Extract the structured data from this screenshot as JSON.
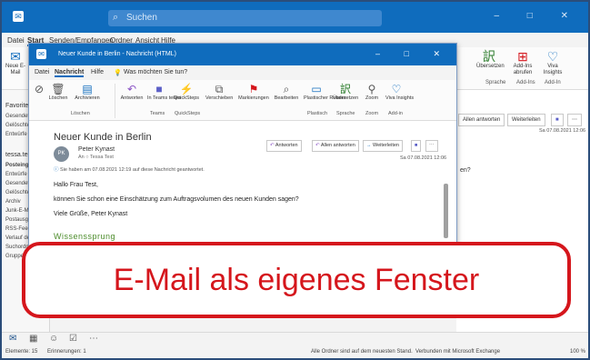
{
  "main_window": {
    "search_placeholder": "Suchen",
    "window_controls": "– □ ✕",
    "menu": [
      "Datei",
      "Start",
      "Senden/Empfangen",
      "Ordner",
      "Ansicht",
      "Hilfe"
    ],
    "ribbon_left": {
      "new_mail": "Neue E-Mail"
    },
    "ribbon_right": {
      "search_fragment": "Suchen",
      "translate": "Übersetzen",
      "addins": "Add-Ins abrufen",
      "viva": "Viva Insights",
      "group_sprache": "Sprache",
      "group_addin1": "Add-Ins",
      "group_addin2": "Add-In"
    },
    "folders": [
      "Favoriten",
      "Gesendete",
      "Gelöschte",
      "Entwürfe",
      "tessa.test",
      "Posteingang",
      "Entwürfe",
      "Gesendete",
      "Gelöschte",
      "Archiv",
      "Junk-E-Mail",
      "Postausgang",
      "RSS-Feeds",
      "Verlauf der",
      "Suchordner",
      "Gruppen"
    ],
    "right_pane": {
      "reply_all": "Allen antworten",
      "forward": "Weiterleiten",
      "date": "Sa 07.08.2021 12:06",
      "question_fragment": "en?"
    },
    "status": {
      "items": "Elemente: 15",
      "unread": "Erinnerungen: 1",
      "sync": "Alle Ordner sind auf dem neuesten Stand.",
      "connected": "Verbunden mit Microsoft Exchange",
      "zoom": "100 %"
    }
  },
  "message_window": {
    "title": "Neuer Kunde in Berlin - Nachricht (HTML)",
    "window_controls": "– □ ✕",
    "menu": {
      "file": "Datei",
      "message": "Nachricht",
      "help": "Hilfe",
      "tellme": "Was möchten Sie tun?"
    },
    "ribbon": {
      "delete": "Löschen",
      "archive": "Archivieren",
      "respond": "Antworten",
      "teams": "In Teams teilen",
      "quicksteps": "QuickSteps",
      "move": "Verschieben",
      "tags": "Markierungen",
      "edit": "Bearbeiten",
      "reader": "Plastischer Reader",
      "translate": "Übersetzen",
      "zoom": "Zoom",
      "viva": "Viva Insights",
      "groups": [
        "Löschen",
        "Teams",
        "QuickSteps",
        "Plastisch",
        "Sprache",
        "Zoom",
        "Add-in"
      ]
    },
    "subject": "Neuer Kunde in Berlin",
    "sender": "Peter Kynast",
    "to": "An  ○ Tessa Test",
    "info": "Sie haben am 07.08.2021 12:19 auf diese Nachricht geantwortet.",
    "actions": {
      "reply": "Antworten",
      "reply_all": "Allen antworten",
      "forward": "Weiterleiten"
    },
    "date": "Sa 07.08.2021 12:06",
    "body": [
      "Hallo Frau Test,",
      "können Sie schon eine Einschätzung zum Auftragsvolumen des neuen Kunden sagen?",
      "Viele Grüße, Peter Kynast"
    ],
    "logo": "Wissenssprung",
    "avatar_initials": "PK"
  },
  "banner": {
    "text": "E-Mail als eigenes Fenster",
    "color": "#d5161c"
  }
}
